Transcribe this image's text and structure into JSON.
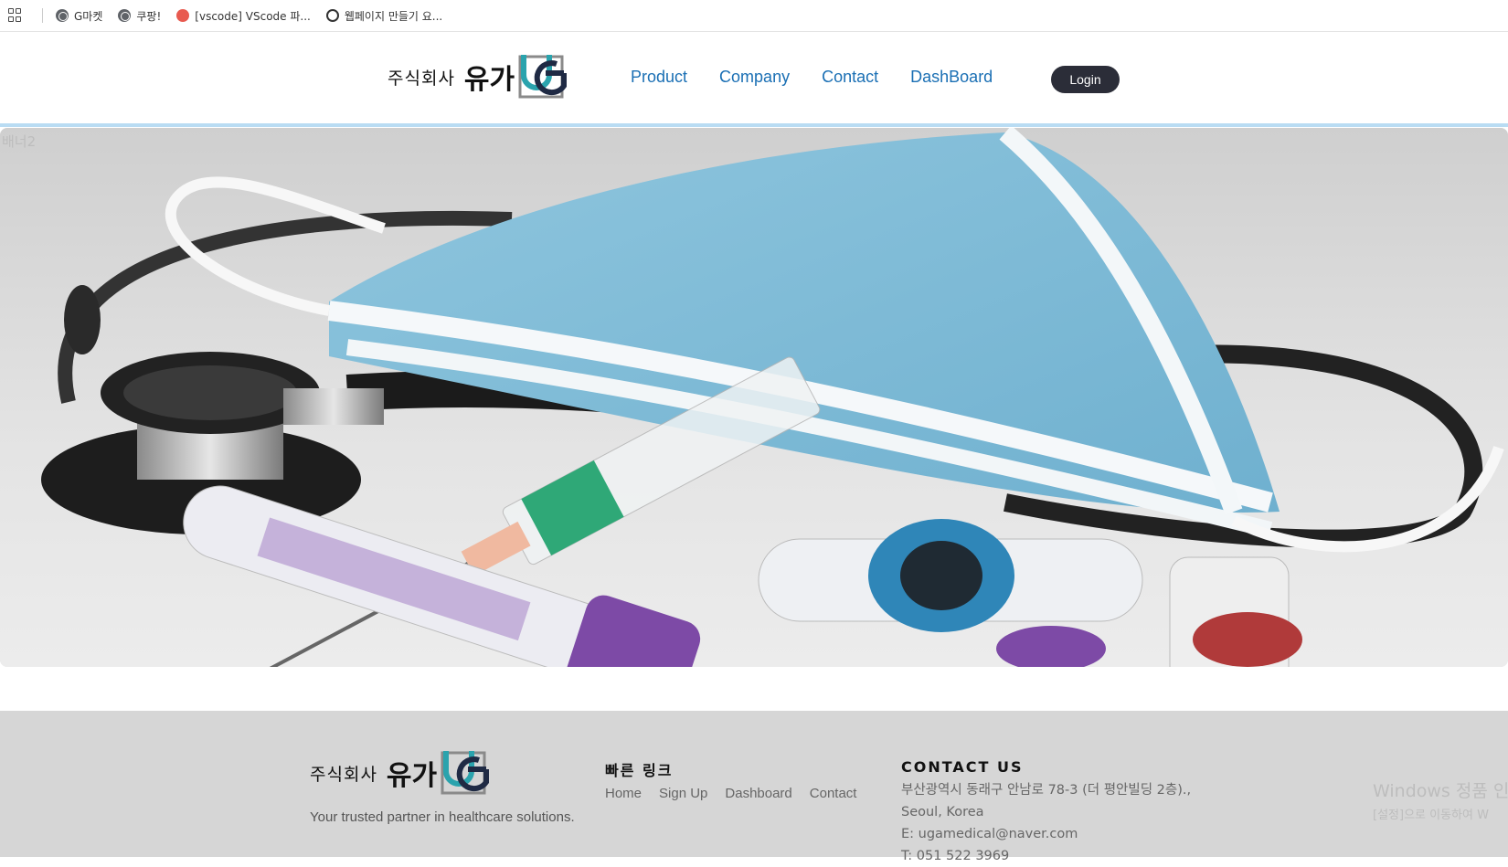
{
  "bookmarks": [
    {
      "label": "G마켓",
      "icon": "globe-icon"
    },
    {
      "label": "쿠팡!",
      "icon": "globe-icon"
    },
    {
      "label": "[vscode] VScode 파...",
      "icon": "vscode-bookmark-icon"
    },
    {
      "label": "웹페이지 만들기 요...",
      "icon": "chatgpt-icon"
    }
  ],
  "header": {
    "logo_text": "주식회사",
    "logo_brand": "유가",
    "nav": [
      "Product",
      "Company",
      "Contact",
      "DashBoard"
    ],
    "login_label": "Login"
  },
  "banner": {
    "alt_text": "배너2"
  },
  "footer": {
    "logo_text": "주식회사",
    "logo_brand": "유가",
    "tagline": "Your trusted partner in healthcare solutions.",
    "quick_title": "빠른 링크",
    "quick_links": [
      "Home",
      "Sign Up",
      "Dashboard",
      "Contact"
    ],
    "contact_title": "CONTACT US",
    "address_line1": "부산광역시 동래구 안남로 78-3 (더 평안빌딩 2층).,",
    "address_line2": "Seoul, Korea",
    "email": "E: ugamedical@naver.com",
    "phone": "T: 051 522 3969"
  },
  "watermark": {
    "line1": "Windows 정품 인",
    "line2": "[설정]으로 이동하여 W"
  },
  "colors": {
    "nav_link": "#1a6fb4",
    "login_bg": "#2b2d38",
    "footer_bg": "#d6d6d6",
    "header_rule": "#b9dcf3"
  }
}
